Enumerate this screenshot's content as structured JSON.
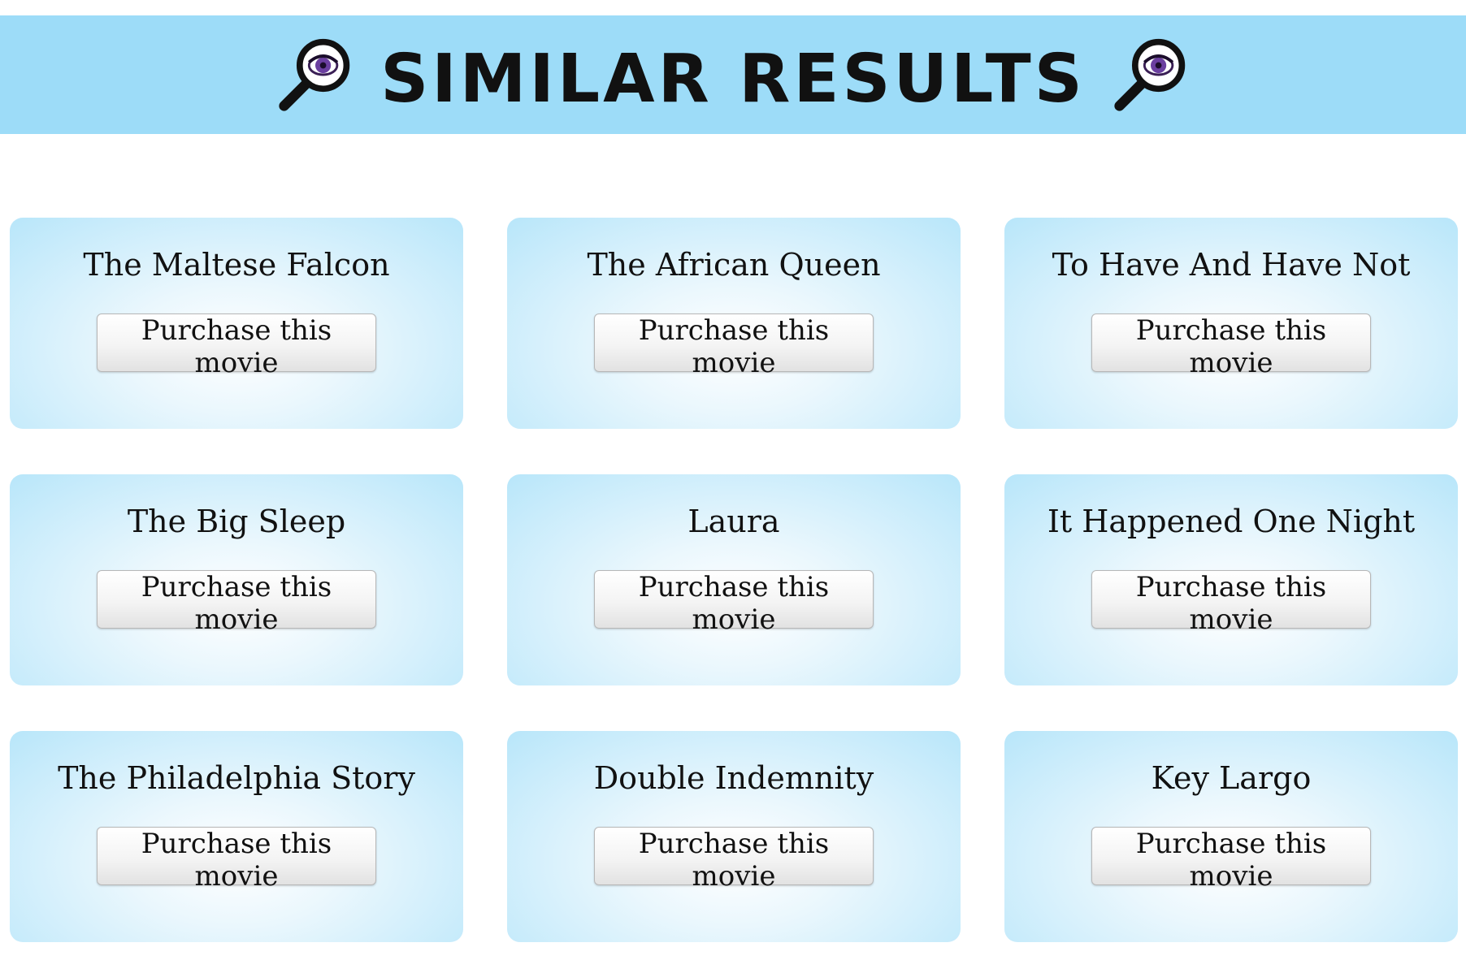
{
  "header": {
    "title": "Similar Results",
    "icon": "magnifying-glass-eye-icon",
    "background_color": "#9ddcf8"
  },
  "results": [
    {
      "title": "The Maltese Falcon",
      "button_label": "Purchase this movie"
    },
    {
      "title": "The African Queen",
      "button_label": "Purchase this movie"
    },
    {
      "title": "To Have And Have Not",
      "button_label": "Purchase this movie"
    },
    {
      "title": "The Big Sleep",
      "button_label": "Purchase this movie"
    },
    {
      "title": "Laura",
      "button_label": "Purchase this movie"
    },
    {
      "title": "It Happened One Night",
      "button_label": "Purchase this movie"
    },
    {
      "title": "The Philadelphia Story",
      "button_label": "Purchase this movie"
    },
    {
      "title": "Double Indemnity",
      "button_label": "Purchase this movie"
    },
    {
      "title": "Key Largo",
      "button_label": "Purchase this movie"
    }
  ],
  "colors": {
    "card_edge": "#b8e6fa",
    "card_center": "#ffffff"
  }
}
